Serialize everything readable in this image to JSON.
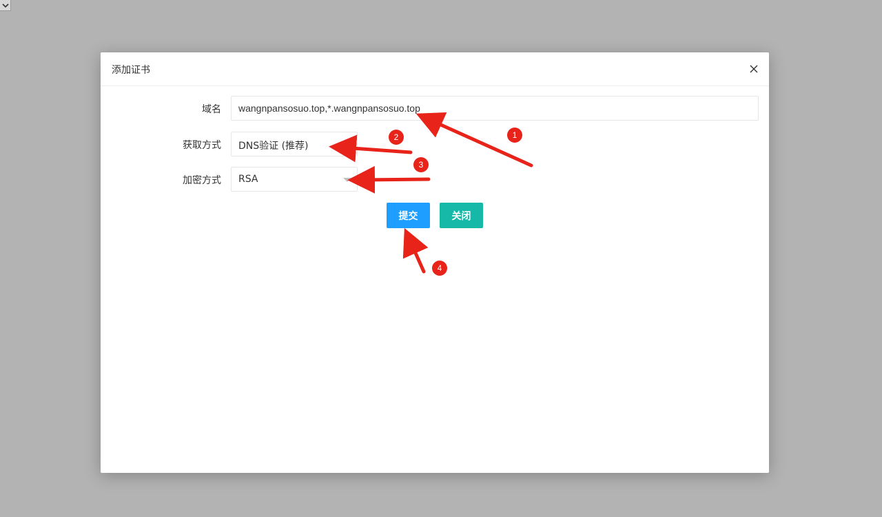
{
  "dialog": {
    "title": "添加证书"
  },
  "form": {
    "domain": {
      "label": "域名",
      "value": "wangnpansosuo.top,*.wangnpansosuo.top"
    },
    "method": {
      "label": "获取方式",
      "selected": "DNS验证 (推荐)"
    },
    "encryption": {
      "label": "加密方式",
      "selected": "RSA"
    }
  },
  "buttons": {
    "submit_label": "提交",
    "close_label": "关闭"
  },
  "annotations": {
    "badges": [
      "1",
      "2",
      "3",
      "4"
    ]
  },
  "colors": {
    "overlay": "#b3b3b3",
    "submit": "#1e9fff",
    "close": "#16b9a8",
    "annotation": "#e8231a"
  }
}
